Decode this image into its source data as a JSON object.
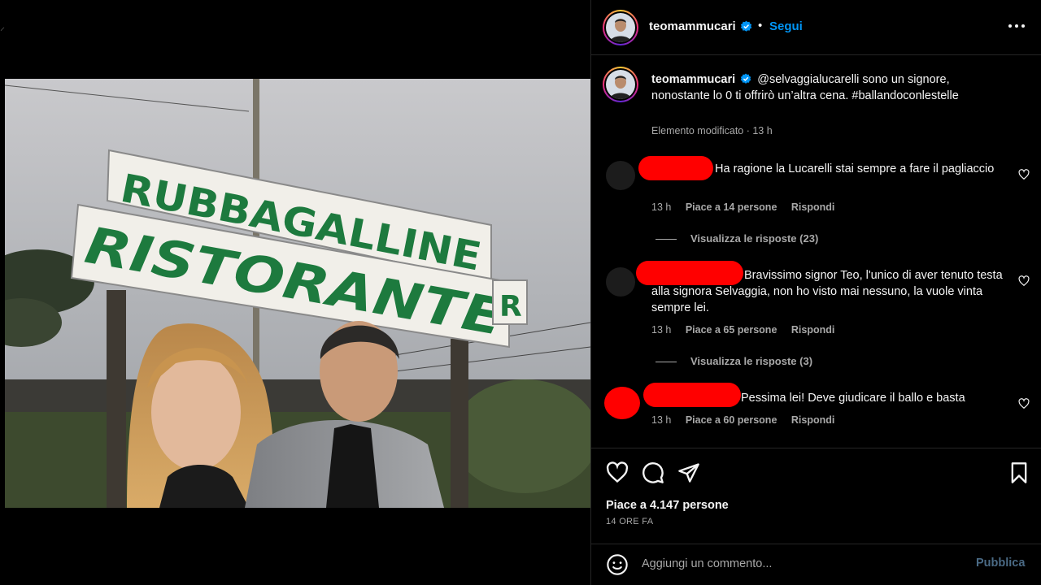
{
  "post": {
    "username": "teomammucari",
    "follow_label": "Segui",
    "separator": "•",
    "caption": {
      "mention": "@selvaggialucarelli",
      "text": " sono un signore, nonostante lo 0 ti offrirò un’altra cena. #ballandoconlestelle",
      "meta": "Elemento modificato · 13 h"
    },
    "image": {
      "sign_top": "RUBBAGALLINE",
      "sign_bottom": "RISTORANTE",
      "sign_side": "R"
    }
  },
  "comments": [
    {
      "text": "Ha ragione la Lucarelli stai sempre a fare il pagliaccio",
      "time": "13 h",
      "likes": "Piace a 14 persone",
      "reply": "Rispondi",
      "view_replies": "Visualizza le risposte (23)"
    },
    {
      "text": "Bravissimo signor Teo, l'unico di aver tenuto testa alla signora Selvaggia, non ho visto mai nessuno, la vuole vinta sempre lei.",
      "time": "13 h",
      "likes": "Piace a 65 persone",
      "reply": "Rispondi",
      "view_replies": "Visualizza le risposte (3)"
    },
    {
      "text": "Pessima lei! Deve giudicare il ballo e basta",
      "time": "13 h",
      "likes": "Piace a 60 persone",
      "reply": "Rispondi"
    }
  ],
  "footer": {
    "likes": "Piace a 4.147 persone",
    "time": "14 ORE FA",
    "comment_placeholder": "Aggiungi un commento...",
    "publish_label": "Pubblica"
  },
  "icons": {
    "verified": "verified-badge-icon",
    "more": "more-options-icon",
    "heart": "heart-icon",
    "comment": "comment-icon",
    "share": "share-icon",
    "save": "bookmark-icon",
    "emoji": "emoji-icon"
  },
  "colors": {
    "accent": "#0095f6",
    "redaction": "#ff0000",
    "publish_disabled": "#4a6a85"
  }
}
